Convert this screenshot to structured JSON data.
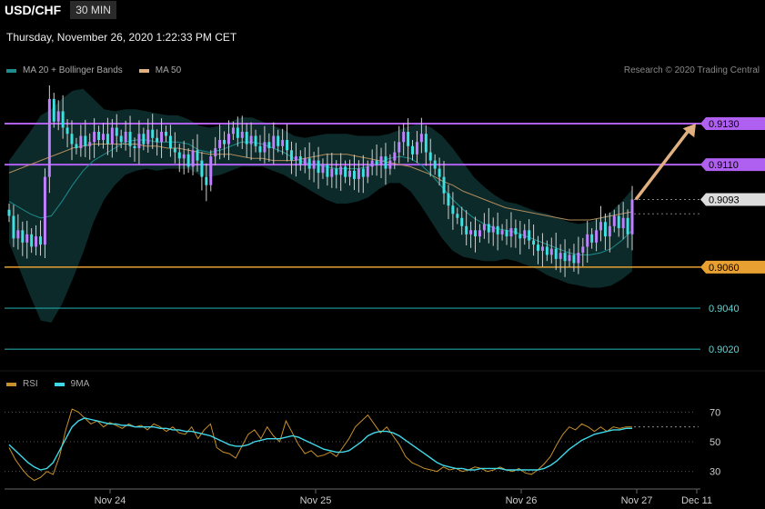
{
  "header": {
    "pair": "USD/CHF",
    "timeframe": "30 MIN"
  },
  "datetime": "Thursday, November 26, 2020 1:22:33 PM CET",
  "legend_main": [
    {
      "label": "MA 20 + Bollinger Bands",
      "color": "#1c8c8c"
    },
    {
      "label": "MA 50",
      "color": "#e0b080"
    }
  ],
  "legend_rsi": [
    {
      "label": "RSI",
      "color": "#c8902a"
    },
    {
      "label": "9MA",
      "color": "#40d8e8"
    }
  ],
  "credit": "Research © 2020 Trading Central",
  "colors": {
    "candle_up": "#c080ff",
    "candle_down": "#40e0e0",
    "resistance": "#b060f0",
    "support": "#e8a030",
    "lower_level": "#20a0a0",
    "current": "#dddddd",
    "arrow": "#e0b080",
    "bands_fill": "#0c2a2a"
  },
  "chart_data": [
    {
      "type": "candlestick",
      "title": "USD/CHF",
      "timeframe": "30 MIN",
      "x_ticks": [
        "Nov 24",
        "Nov 25",
        "Nov 26",
        "Nov 27",
        "Dec 11"
      ],
      "ylim": [
        0.9013,
        0.9161
      ],
      "levels": [
        {
          "value": 0.913,
          "label": "0.9130",
          "kind": "resistance"
        },
        {
          "value": 0.911,
          "label": "0.9110",
          "kind": "resistance"
        },
        {
          "value": 0.9093,
          "label": "0.9093",
          "kind": "current"
        },
        {
          "value": 0.906,
          "label": "0.9060",
          "kind": "support"
        },
        {
          "value": 0.904,
          "label": "0.9040",
          "kind": "lower"
        },
        {
          "value": 0.902,
          "label": "0.9020",
          "kind": "lower"
        }
      ],
      "projection": {
        "from": 0.9093,
        "to": 0.913
      },
      "closes": [
        0.9085,
        0.9074,
        0.9078,
        0.9072,
        0.9076,
        0.907,
        0.9075,
        0.9071,
        0.9104,
        0.9142,
        0.9131,
        0.9136,
        0.9128,
        0.9125,
        0.912,
        0.9118,
        0.9124,
        0.9119,
        0.9121,
        0.9126,
        0.9122,
        0.9125,
        0.912,
        0.9128,
        0.9124,
        0.9121,
        0.9126,
        0.9119,
        0.9118,
        0.9125,
        0.912,
        0.9127,
        0.9123,
        0.9121,
        0.9126,
        0.9124,
        0.9118,
        0.9116,
        0.9113,
        0.9115,
        0.9109,
        0.9117,
        0.9112,
        0.9104,
        0.91,
        0.9114,
        0.9118,
        0.9122,
        0.912,
        0.9125,
        0.9128,
        0.9123,
        0.9126,
        0.912,
        0.9124,
        0.9119,
        0.9116,
        0.9121,
        0.9118,
        0.9124,
        0.9119,
        0.9122,
        0.9117,
        0.9112,
        0.9114,
        0.911,
        0.9113,
        0.9108,
        0.9112,
        0.9106,
        0.911,
        0.9104,
        0.9108,
        0.9105,
        0.9109,
        0.9104,
        0.9107,
        0.9103,
        0.9108,
        0.9104,
        0.9109,
        0.9112,
        0.911,
        0.9114,
        0.9108,
        0.9112,
        0.9116,
        0.9121,
        0.9126,
        0.9119,
        0.9115,
        0.9121,
        0.9125,
        0.9116,
        0.9112,
        0.9108,
        0.9104,
        0.9096,
        0.909,
        0.9086,
        0.9084,
        0.908,
        0.9076,
        0.9078,
        0.9075,
        0.9078,
        0.9081,
        0.9077,
        0.908,
        0.9076,
        0.9078,
        0.9075,
        0.9079,
        0.9076,
        0.9074,
        0.9078,
        0.9073,
        0.9071,
        0.9068,
        0.907,
        0.9066,
        0.9069,
        0.9064,
        0.9067,
        0.9063,
        0.9066,
        0.9062,
        0.9067,
        0.907,
        0.9076,
        0.9072,
        0.9078,
        0.9082,
        0.9075,
        0.908,
        0.9085,
        0.9079,
        0.9084,
        0.9076,
        0.9093
      ],
      "ma20_approx": [
        0.9092,
        0.9089,
        0.9086,
        0.9084,
        0.9085,
        0.9092,
        0.91,
        0.9107,
        0.9112,
        0.9115,
        0.9118,
        0.9121,
        0.9122,
        0.9122,
        0.9121,
        0.9121,
        0.9121,
        0.912,
        0.9117,
        0.9116,
        0.9117,
        0.9119,
        0.9121,
        0.9121,
        0.912,
        0.9118,
        0.9116,
        0.9113,
        0.9111,
        0.911,
        0.9109,
        0.9108,
        0.9108,
        0.9108,
        0.9109,
        0.9111,
        0.9113,
        0.9114,
        0.9113,
        0.911,
        0.9105,
        0.9099,
        0.9093,
        0.9088,
        0.9084,
        0.9081,
        0.9079,
        0.9078,
        0.9077,
        0.9075,
        0.9073,
        0.9071,
        0.9069,
        0.9067,
        0.9066,
        0.9066,
        0.9067,
        0.9069,
        0.9073,
        0.9078
      ],
      "ma50_approx": [
        0.9106,
        0.9108,
        0.911,
        0.9112,
        0.9114,
        0.9116,
        0.9118,
        0.9119,
        0.912,
        0.912,
        0.912,
        0.912,
        0.912,
        0.9119,
        0.9119,
        0.9118,
        0.9118,
        0.9117,
        0.9116,
        0.9115,
        0.9115,
        0.9115,
        0.9114,
        0.9113,
        0.9113,
        0.9112,
        0.9112,
        0.9112,
        0.9113,
        0.9114,
        0.9115,
        0.9115,
        0.9115,
        0.9114,
        0.9113,
        0.9112,
        0.9111,
        0.911,
        0.9109,
        0.9107,
        0.9105,
        0.9102,
        0.91,
        0.9097,
        0.9095,
        0.9093,
        0.9091,
        0.9089,
        0.9088,
        0.9087,
        0.9086,
        0.9085,
        0.9084,
        0.9083,
        0.9083,
        0.9083,
        0.9084,
        0.9085,
        0.9086,
        0.9087
      ],
      "bollinger_band_width_approx": [
        0.002,
        0.003,
        0.004,
        0.005,
        0.0052,
        0.005,
        0.0046,
        0.004,
        0.003,
        0.0022,
        0.0018,
        0.0016,
        0.0015,
        0.0014,
        0.0014,
        0.0013,
        0.0013,
        0.0012,
        0.0012,
        0.0012,
        0.0012,
        0.0012,
        0.0012,
        0.0012,
        0.0011,
        0.0011,
        0.0011,
        0.0011,
        0.0012,
        0.0014,
        0.0016,
        0.0017,
        0.0017,
        0.0016,
        0.0015,
        0.0013,
        0.0012,
        0.0013,
        0.0016,
        0.002,
        0.0023,
        0.0025,
        0.0025,
        0.0023,
        0.002,
        0.0018,
        0.0016,
        0.0014,
        0.0014,
        0.0014,
        0.0014,
        0.0015,
        0.0015,
        0.0015,
        0.0015,
        0.0016,
        0.0017,
        0.0018,
        0.0019,
        0.002
      ]
    },
    {
      "type": "line",
      "title": "RSI",
      "y_ticks": [
        70,
        50,
        30
      ],
      "ylim": [
        20,
        80
      ],
      "series": [
        {
          "name": "RSI",
          "values": [
            46,
            38,
            32,
            27,
            24,
            26,
            30,
            28,
            40,
            58,
            72,
            70,
            66,
            62,
            64,
            60,
            63,
            61,
            59,
            62,
            60,
            61,
            58,
            62,
            60,
            57,
            60,
            56,
            55,
            60,
            52,
            58,
            62,
            46,
            43,
            42,
            39,
            47,
            55,
            58,
            52,
            60,
            54,
            50,
            64,
            56,
            48,
            42,
            44,
            40,
            41,
            43,
            40,
            46,
            52,
            60,
            64,
            68,
            62,
            56,
            60,
            54,
            48,
            40,
            36,
            34,
            32,
            31,
            30,
            33,
            31,
            32,
            30,
            31,
            33,
            32,
            30,
            31,
            33,
            31,
            30,
            32,
            29,
            28,
            31,
            35,
            40,
            48,
            55,
            60,
            58,
            62,
            60,
            57,
            60,
            57,
            60,
            59,
            60,
            60
          ]
        },
        {
          "name": "9MA",
          "values": [
            48,
            44,
            40,
            36,
            33,
            31,
            32,
            36,
            44,
            52,
            60,
            64,
            66,
            65,
            64,
            63,
            62,
            62,
            61,
            61,
            60,
            60,
            60,
            60,
            59,
            59,
            58,
            58,
            57,
            57,
            56,
            55,
            54,
            52,
            50,
            48,
            47,
            47,
            48,
            50,
            51,
            52,
            52,
            52,
            53,
            54,
            53,
            51,
            49,
            47,
            45,
            44,
            43,
            43,
            44,
            47,
            50,
            54,
            56,
            57,
            57,
            56,
            54,
            51,
            48,
            45,
            42,
            39,
            36,
            34,
            33,
            32,
            32,
            31,
            31,
            32,
            32,
            32,
            32,
            31,
            31,
            31,
            31,
            31,
            31,
            32,
            34,
            37,
            41,
            45,
            48,
            51,
            53,
            55,
            56,
            57,
            58,
            58,
            59,
            59
          ]
        }
      ]
    }
  ]
}
